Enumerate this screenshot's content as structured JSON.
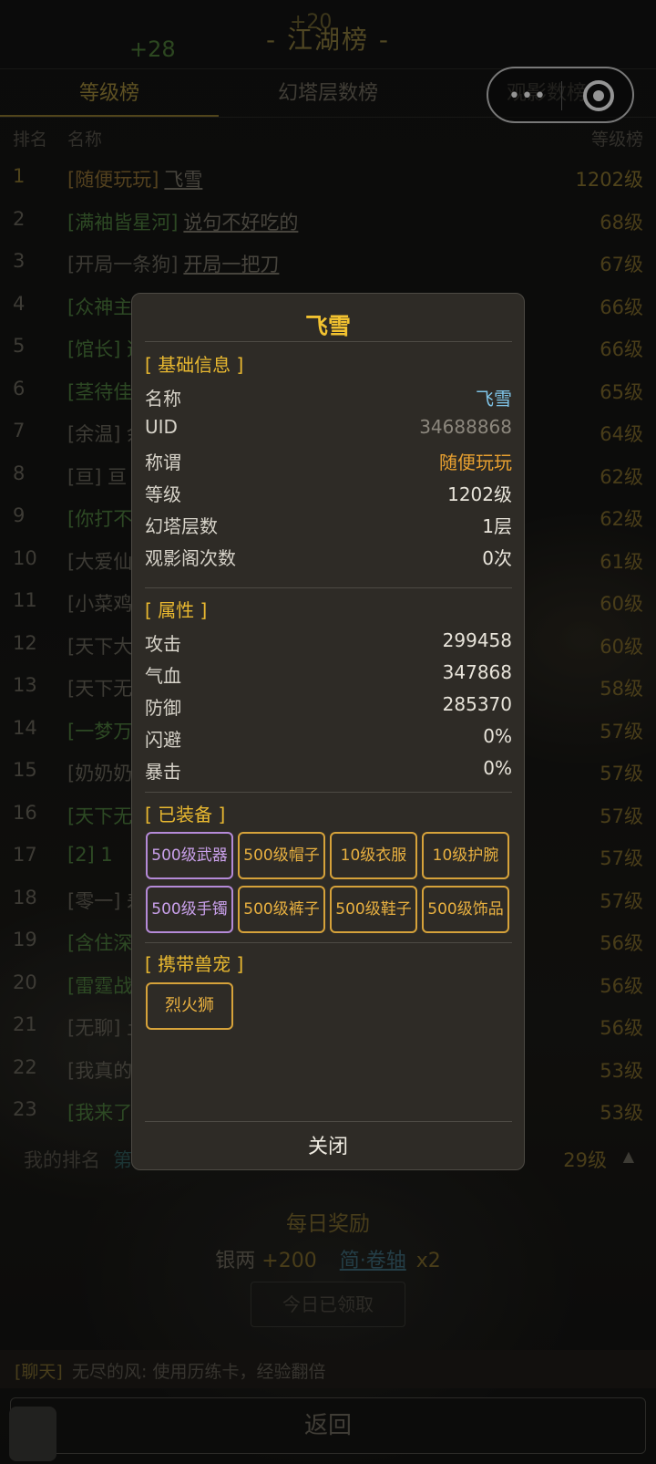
{
  "header": {
    "title": "- 江湖榜 -",
    "float_a": "+28",
    "float_b": "+20"
  },
  "tabs": [
    {
      "label": "等级榜",
      "active": true
    },
    {
      "label": "幻塔层数榜",
      "active": false
    },
    {
      "label": "观影数榜",
      "active": false
    }
  ],
  "capsule": {
    "more": "•••"
  },
  "columns": {
    "rank": "排名",
    "name": "名称",
    "level": "等级榜"
  },
  "rows": [
    {
      "rank": "1",
      "tag": "[随便玩玩]",
      "name": "飞雪",
      "level": "1202级"
    },
    {
      "rank": "2",
      "tag": "[满袖皆星河]",
      "name": "说句不好吃的",
      "level": "68级"
    },
    {
      "rank": "3",
      "tag": "[开局一条狗]",
      "name": "开局一把刀",
      "level": "67级"
    },
    {
      "rank": "4",
      "tag": "[众神主",
      "name": "",
      "level": "66级"
    },
    {
      "rank": "5",
      "tag": "[馆长] 逍",
      "name": "",
      "level": "66级"
    },
    {
      "rank": "6",
      "tag": "[茎待佳",
      "name": "",
      "level": "65级"
    },
    {
      "rank": "7",
      "tag": "[余温] 余",
      "name": "",
      "level": "64级"
    },
    {
      "rank": "8",
      "tag": "[亘] 亘",
      "name": "",
      "level": "62级"
    },
    {
      "rank": "9",
      "tag": "[你打不",
      "name": "",
      "level": "62级"
    },
    {
      "rank": "10",
      "tag": "[大爱仙",
      "name": "",
      "level": "61级"
    },
    {
      "rank": "11",
      "tag": "[小菜鸡",
      "name": "",
      "level": "60级"
    },
    {
      "rank": "12",
      "tag": "[天下大",
      "name": "",
      "level": "60级"
    },
    {
      "rank": "13",
      "tag": "[天下无",
      "name": "",
      "level": "58级"
    },
    {
      "rank": "14",
      "tag": "[一梦万",
      "name": "",
      "level": "57级"
    },
    {
      "rank": "15",
      "tag": "[奶奶奶",
      "name": "",
      "level": "57级"
    },
    {
      "rank": "16",
      "tag": "[天下无",
      "name": "",
      "level": "57级"
    },
    {
      "rank": "17",
      "tag": "[2] 1",
      "name": "",
      "level": "57级"
    },
    {
      "rank": "18",
      "tag": "[零一] 差",
      "name": "",
      "level": "57级"
    },
    {
      "rank": "19",
      "tag": "[含住深",
      "name": "",
      "level": "56级"
    },
    {
      "rank": "20",
      "tag": "[雷霆战",
      "name": "",
      "level": "56级"
    },
    {
      "rank": "21",
      "tag": "[无聊] 土",
      "name": "",
      "level": "56级"
    },
    {
      "rank": "22",
      "tag": "[我真的",
      "name": "",
      "level": "53级"
    },
    {
      "rank": "23",
      "tag": "[我来了",
      "name": "",
      "level": "53级"
    }
  ],
  "my_rank": {
    "label": "我的排名",
    "value": "第",
    "level": "29级",
    "arrow": "▲"
  },
  "daily": {
    "title": "每日奖励",
    "silver_label": "银两",
    "silver_amount": "+200",
    "item": "简·卷轴",
    "item_count": "x2",
    "claim": "今日已领取"
  },
  "chat": {
    "tag": "[聊天]",
    "message": "无尽的风: 使用历练卡，经验翻倍"
  },
  "back": "返回",
  "modal": {
    "title": "飞雪",
    "basic_title": "[ 基础信息 ]",
    "basic": [
      {
        "key": "名称",
        "value": "飞雪"
      },
      {
        "key": "UID",
        "value": "34688868"
      },
      {
        "key": "称谓",
        "value": "随便玩玩"
      },
      {
        "key": "等级",
        "value": "1202级"
      },
      {
        "key": "幻塔层数",
        "value": "1层"
      },
      {
        "key": "观影阁次数",
        "value": "0次"
      }
    ],
    "attr_title": "[ 属性 ]",
    "attrs": [
      {
        "key": "攻击",
        "value": "299458"
      },
      {
        "key": "气血",
        "value": "347868"
      },
      {
        "key": "防御",
        "value": "285370"
      },
      {
        "key": "闪避",
        "value": "0%"
      },
      {
        "key": "暴击",
        "value": "0%"
      }
    ],
    "equip_title": "[ 已装备 ]",
    "equipment": [
      "500级武器",
      "500级帽子",
      "10级衣服",
      "10级护腕",
      "500级手镯",
      "500级裤子",
      "500级鞋子",
      "500级饰品"
    ],
    "pet_title": "[ 携带兽宠 ]",
    "pet": "烈火狮",
    "close": "关闭"
  },
  "colors": {
    "gold": "#f2c230",
    "purple": "#b58ad8",
    "cyan": "#7fc4e8",
    "orange": "#e8a030"
  }
}
